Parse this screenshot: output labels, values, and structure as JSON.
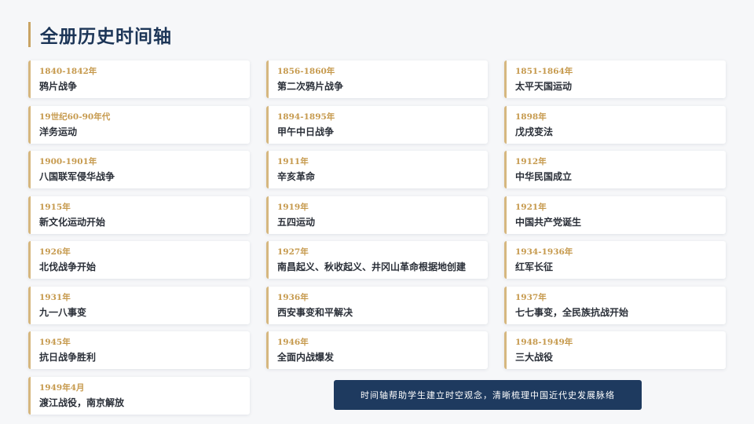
{
  "page": {
    "title": "全册历史时间轴",
    "summary": "时间轴帮助学生建立时空观念，清晰梳理中国近代史发展脉络"
  },
  "timeline": [
    {
      "year": "1840-1842年",
      "event": "鸦片战争"
    },
    {
      "year": "1856-1860年",
      "event": "第二次鸦片战争"
    },
    {
      "year": "1851-1864年",
      "event": "太平天国运动"
    },
    {
      "year": "19世纪60-90年代",
      "event": "洋务运动"
    },
    {
      "year": "1894-1895年",
      "event": "甲午中日战争"
    },
    {
      "year": "1898年",
      "event": "戊戌变法"
    },
    {
      "year": "1900-1901年",
      "event": "八国联军侵华战争"
    },
    {
      "year": "1911年",
      "event": "辛亥革命"
    },
    {
      "year": "1912年",
      "event": "中华民国成立"
    },
    {
      "year": "1915年",
      "event": "新文化运动开始"
    },
    {
      "year": "1919年",
      "event": "五四运动"
    },
    {
      "year": "1921年",
      "event": "中国共产党诞生"
    },
    {
      "year": "1926年",
      "event": "北伐战争开始"
    },
    {
      "year": "1927年",
      "event": "南昌起义、秋收起义、井冈山革命根据地创建"
    },
    {
      "year": "1934-1936年",
      "event": "红军长征"
    },
    {
      "year": "1931年",
      "event": "九一八事变"
    },
    {
      "year": "1936年",
      "event": "西安事变和平解决"
    },
    {
      "year": "1937年",
      "event": "七七事变，全民族抗战开始"
    },
    {
      "year": "1945年",
      "event": "抗日战争胜利"
    },
    {
      "year": "1946年",
      "event": "全面内战爆发"
    },
    {
      "year": "1948-1949年",
      "event": "三大战役"
    },
    {
      "year": "1949年4月",
      "event": "渡江战役，南京解放"
    }
  ],
  "colors": {
    "title": "#1c3557",
    "accent": "#c9a464",
    "year": "#c69a4e",
    "summary_bg": "#1e3a5f"
  }
}
